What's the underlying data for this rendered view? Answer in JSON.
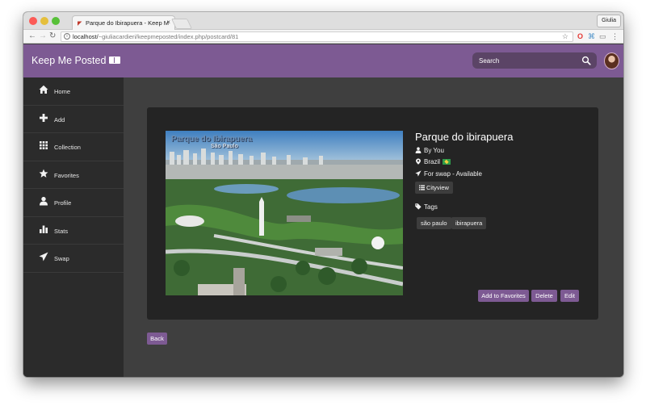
{
  "browser": {
    "tab_title": "Parque do Ibirapuera - Keep M",
    "tab_close": "×",
    "profile_name": "Giulia",
    "url_host": "localhost/",
    "url_path": "~giuliacardieri/keepmeposted/index.php/postcard/81"
  },
  "app": {
    "brand": "Keep Me Posted",
    "search": {
      "placeholder": "Search"
    },
    "accent_color": "#7d5a93"
  },
  "sidebar": {
    "items": [
      {
        "label": "Home",
        "icon": "home-icon"
      },
      {
        "label": "Add",
        "icon": "plus-icon"
      },
      {
        "label": "Collection",
        "icon": "grid-icon"
      },
      {
        "label": "Favorites",
        "icon": "star-icon"
      },
      {
        "label": "Profile",
        "icon": "user-icon"
      },
      {
        "label": "Stats",
        "icon": "bar-chart-icon"
      },
      {
        "label": "Swap",
        "icon": "send-icon"
      }
    ]
  },
  "postcard": {
    "image_caption_line1": "Parque do Ibirapuera",
    "image_caption_line2": "São Paulo",
    "title": "Parque do ibirapuera",
    "owner": "By You",
    "country": "Brazil",
    "swap_status": "For swap - Available",
    "category": "Cityview",
    "tags_label": "Tags",
    "tags": [
      "são paulo",
      "ibirapuera"
    ],
    "actions": {
      "favorite": "Add to Favorites",
      "delete": "Delete",
      "edit": "Edit"
    },
    "back": "Back"
  }
}
